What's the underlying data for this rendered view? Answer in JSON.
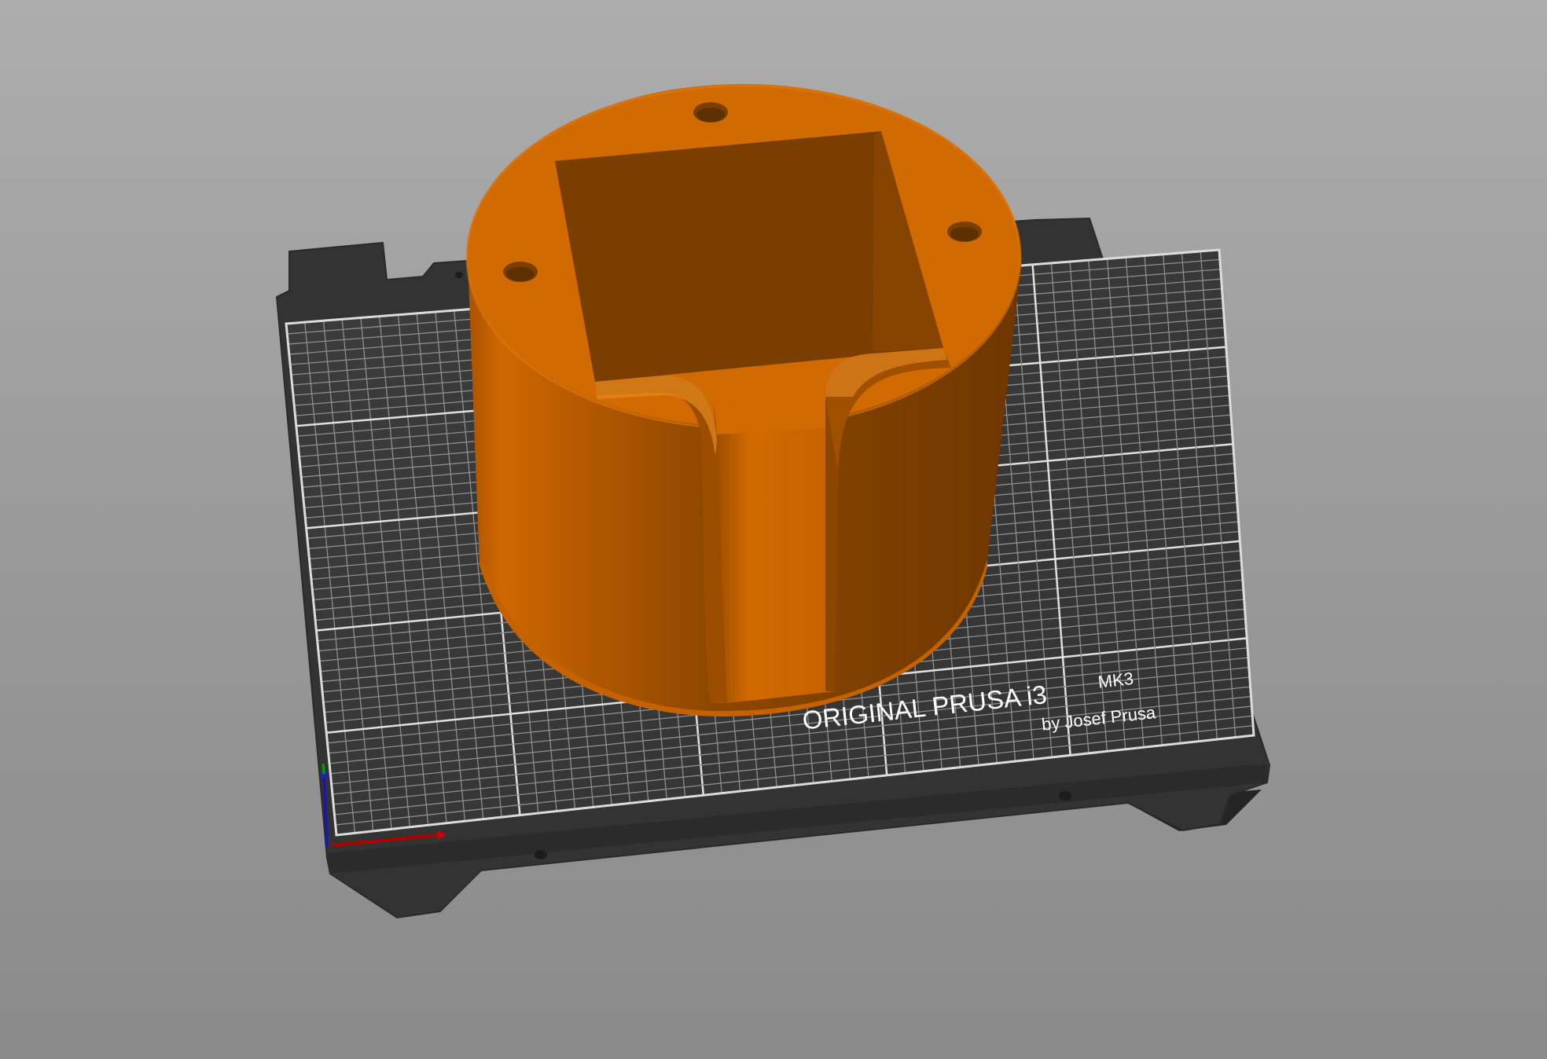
{
  "viewport": {
    "background_top": "#adadad",
    "background_bottom": "#8a8a8a"
  },
  "bed": {
    "brand_line1": "ORIGINAL PRUSA i3",
    "brand_model": "MK3",
    "brand_line2": "by Josef Prusa",
    "plate_color": "#343434",
    "sheet_color": "#3a3a3a",
    "grid_color": "#bdbdbd"
  },
  "model": {
    "color": "#d16a00",
    "shadow_color": "#7a3f00"
  },
  "axes": {
    "x_color": "#c00000",
    "y_color": "#00a000",
    "z_color": "#0000c0"
  }
}
